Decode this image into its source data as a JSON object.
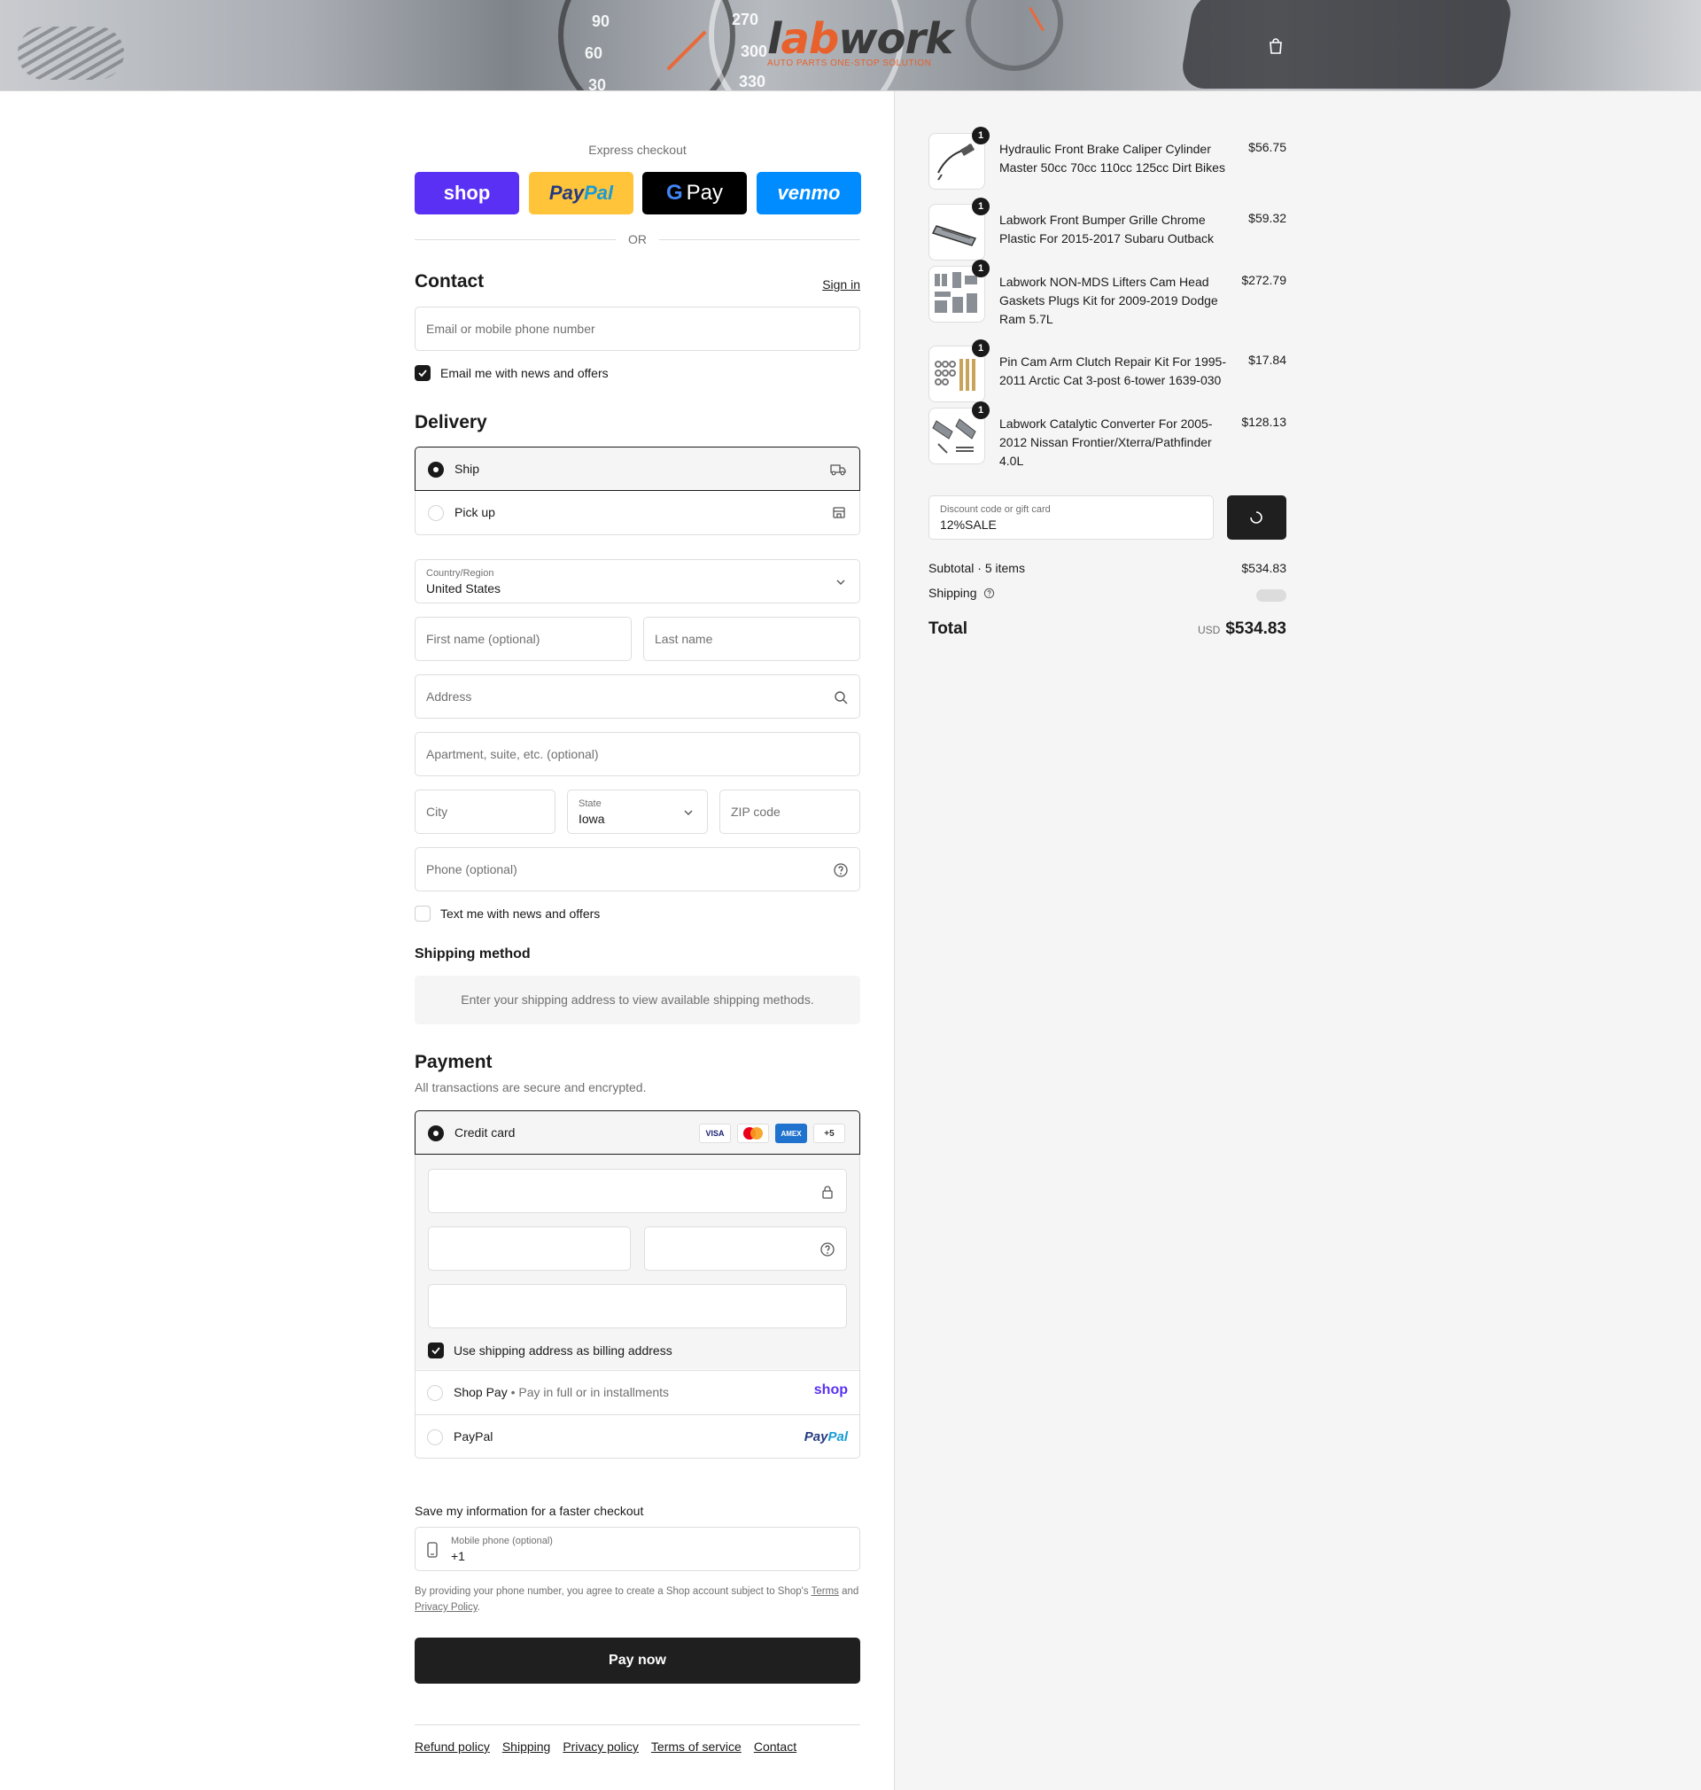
{
  "header": {
    "logo_main": "labwork",
    "logo_tagline": "AUTO PARTS ONE-STOP SOLUTION",
    "cart_icon": "shopping-bag-icon",
    "gauge_numbers": [
      "90",
      "60",
      "30",
      "270",
      "300",
      "330"
    ]
  },
  "express": {
    "label": "Express checkout",
    "shop": "shop",
    "paypal_a": "Pay",
    "paypal_b": "Pal",
    "gpay": "Pay",
    "gpay_g": "G",
    "venmo": "venmo",
    "or": "OR"
  },
  "contact": {
    "title": "Contact",
    "sign_in": "Sign in",
    "email_placeholder": "Email or mobile phone number",
    "email_news": "Email me with news and offers",
    "email_news_checked": true
  },
  "delivery": {
    "title": "Delivery",
    "options": [
      {
        "label": "Ship",
        "icon": "truck-icon",
        "selected": true
      },
      {
        "label": "Pick up",
        "icon": "store-icon",
        "selected": false
      }
    ],
    "country_label": "Country/Region",
    "country_value": "United States",
    "first_name": "First name (optional)",
    "last_name": "Last name",
    "address": "Address",
    "apartment": "Apartment, suite, etc. (optional)",
    "city": "City",
    "state_label": "State",
    "state_value": "Iowa",
    "zip": "ZIP code",
    "phone": "Phone (optional)",
    "text_news": "Text me with news and offers"
  },
  "shipping_method": {
    "title": "Shipping method",
    "info": "Enter your shipping address to view available shipping methods."
  },
  "payment": {
    "title": "Payment",
    "subtitle": "All transactions are secure and encrypted.",
    "credit_card": "Credit card",
    "card_logos": [
      "VISA",
      "AMEX",
      "+5"
    ],
    "billing_same": "Use shipping address as billing address",
    "shop_pay": "Shop Pay",
    "shop_pay_note": "Pay in full or in installments",
    "shop_logo": "shop",
    "paypal": "PayPal",
    "paypal_logo_a": "Pay",
    "paypal_logo_b": "Pal"
  },
  "save_info": {
    "title": "Save my information for a faster checkout",
    "phone_label": "Mobile phone (optional)",
    "phone_value": "+1",
    "legal_prefix": "By providing your phone number, you agree to create a Shop account subject to Shop's",
    "terms": "Terms",
    "and": "and",
    "privacy": "Privacy Policy",
    "period": "."
  },
  "pay_now": "Pay now",
  "footer": [
    "Refund policy",
    "Shipping",
    "Privacy policy",
    "Terms of service",
    "Contact"
  ],
  "cart": {
    "items": [
      {
        "qty": "1",
        "name": "Hydraulic Front Brake Caliper Cylinder Master 50cc 70cc 110cc 125cc Dirt Bikes",
        "price": "$56.75"
      },
      {
        "qty": "1",
        "name": "Labwork Front Bumper Grille Chrome Plastic For 2015-2017 Subaru Outback",
        "price": "$59.32"
      },
      {
        "qty": "1",
        "name": "Labwork NON-MDS Lifters Cam Head Gaskets Plugs Kit for 2009-2019 Dodge Ram 5.7L",
        "price": "$272.79"
      },
      {
        "qty": "1",
        "name": "Pin Cam Arm Clutch Repair Kit For 1995-2011 Arctic Cat 3-post 6-tower 1639-030",
        "price": "$17.84"
      },
      {
        "qty": "1",
        "name": "Labwork Catalytic Converter For 2005-2012 Nissan Frontier/Xterra/Pathfinder 4.0L",
        "price": "$128.13"
      }
    ],
    "discount_label": "Discount code or gift card",
    "discount_value": "12%SALE",
    "subtotal_label": "Subtotal · 5 items",
    "subtotal_value": "$534.83",
    "shipping_label": "Shipping",
    "total_label": "Total",
    "currency": "USD",
    "total_value": "$534.83"
  }
}
